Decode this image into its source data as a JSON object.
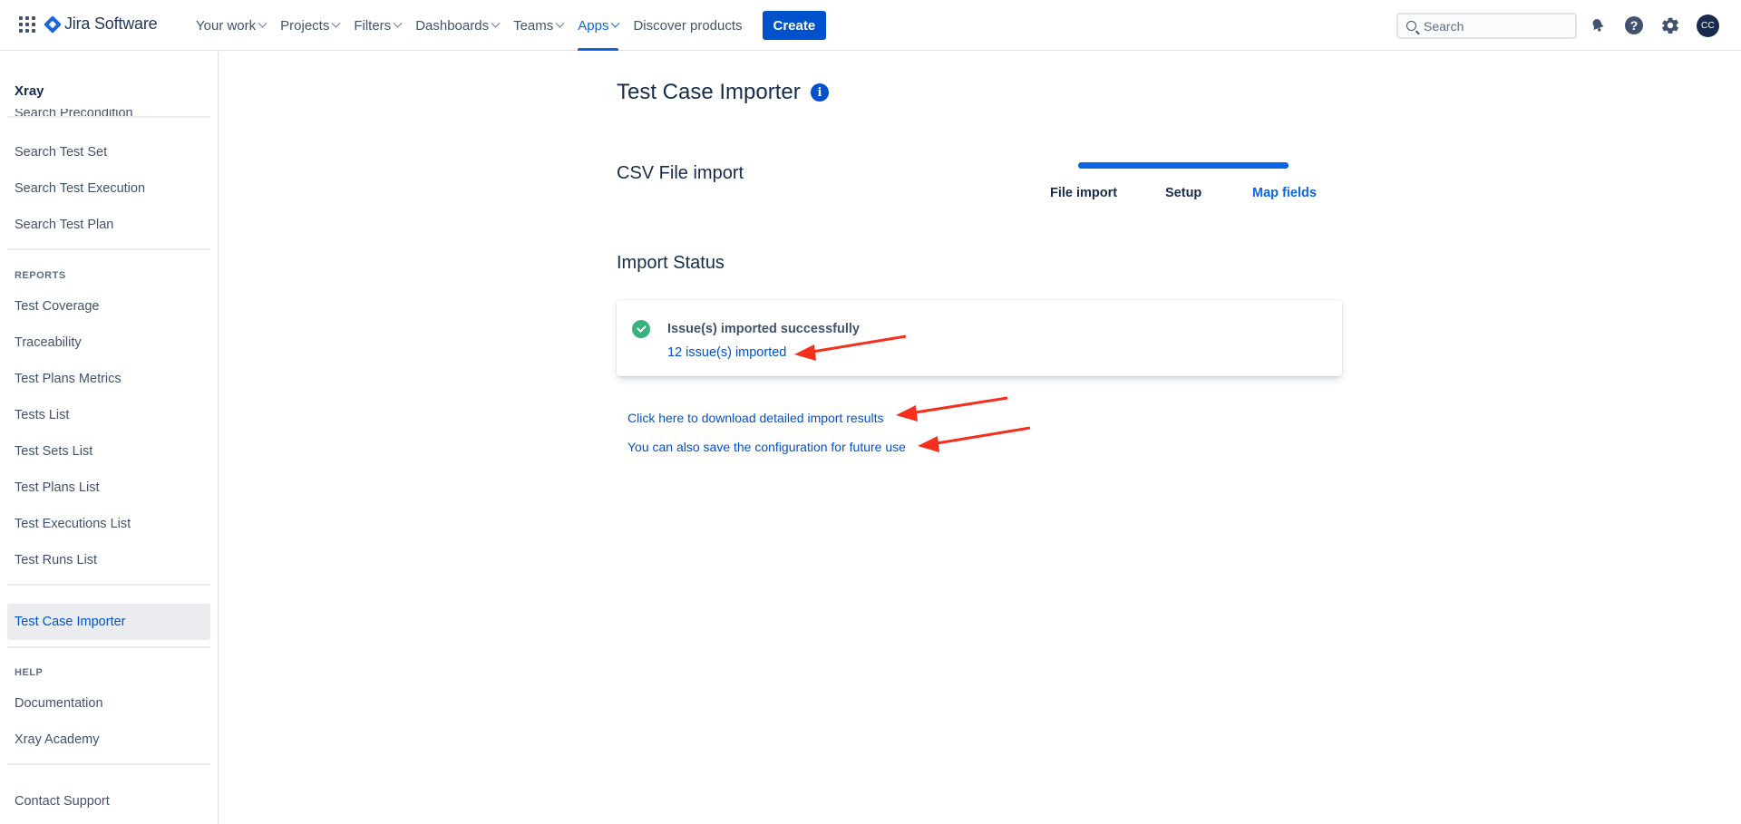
{
  "topbar": {
    "logo_text": "Jira Software",
    "nav": [
      {
        "label": "Your work",
        "dropdown": true
      },
      {
        "label": "Projects",
        "dropdown": true
      },
      {
        "label": "Filters",
        "dropdown": true
      },
      {
        "label": "Dashboards",
        "dropdown": true
      },
      {
        "label": "Teams",
        "dropdown": true
      },
      {
        "label": "Apps",
        "dropdown": true,
        "active": true
      },
      {
        "label": "Discover products",
        "dropdown": false
      }
    ],
    "create_label": "Create",
    "search_placeholder": "Search",
    "avatar_initials": "CC"
  },
  "sidebar": {
    "title": "Xray",
    "clipped_item": "Search Precondition",
    "search_items": [
      "Search Test Set",
      "Search Test Execution",
      "Search Test Plan"
    ],
    "reports_heading": "REPORTS",
    "report_items": [
      "Test Coverage",
      "Traceability",
      "Test Plans Metrics",
      "Tests List",
      "Test Sets List",
      "Test Plans List",
      "Test Executions List",
      "Test Runs List"
    ],
    "selected_item": "Test Case Importer",
    "help_heading": "HELP",
    "help_items": [
      "Documentation",
      "Xray Academy"
    ],
    "contact_item": "Contact Support"
  },
  "main": {
    "page_title": "Test Case Importer",
    "info_icon": "i",
    "csv_title": "CSV File import",
    "steps": [
      "File import",
      "Setup",
      "Map fields"
    ],
    "current_step": "Map fields",
    "progress": 1.0,
    "import_status_title": "Import Status",
    "status": {
      "heading": "Issue(s) imported successfully",
      "link": "12 issue(s) imported"
    },
    "links": {
      "download": "Click here to download detailed import results",
      "save_config": "You can also save the configuration for future use"
    }
  },
  "colors": {
    "accent": "#0c66e4",
    "link": "#0052cc",
    "success": "#36b37e",
    "annotation": "#f4301c"
  },
  "icons": [
    "app-switcher-icon",
    "jira-logo-icon",
    "search-icon",
    "bell-icon",
    "help-icon",
    "gear-icon",
    "info-icon",
    "check-circle-icon",
    "arrow-annotation"
  ]
}
